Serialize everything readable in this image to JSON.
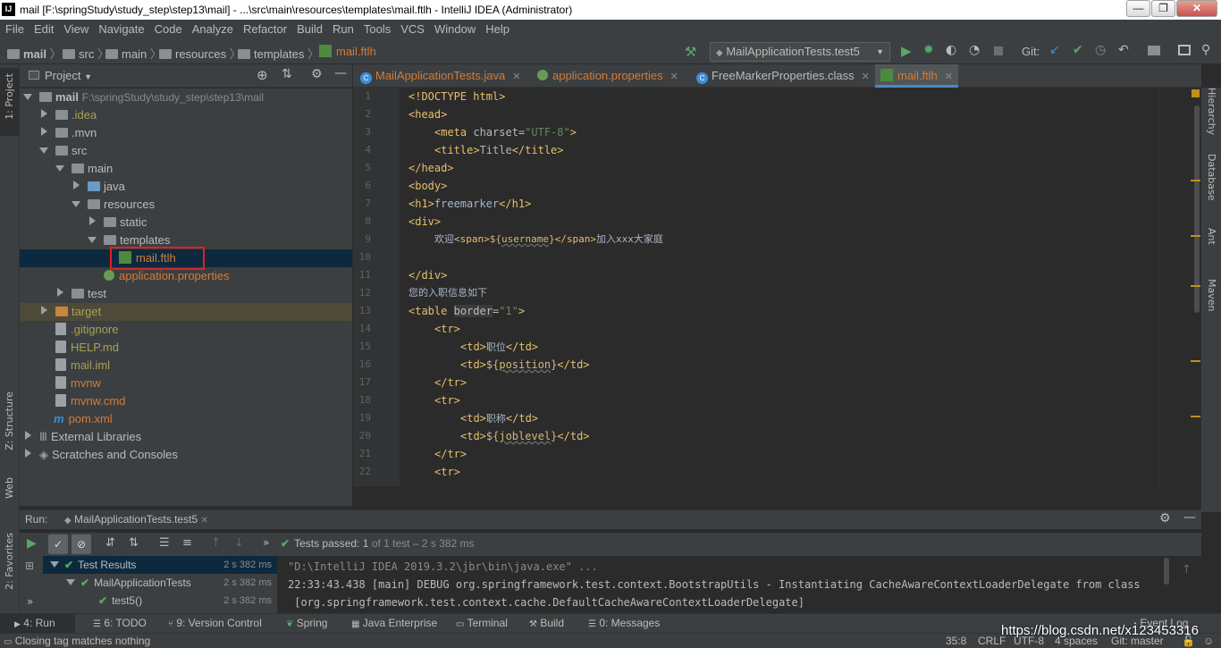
{
  "window": {
    "title": "mail [F:\\springStudy\\study_step\\step13\\mail] - ...\\src\\main\\resources\\templates\\mail.ftlh - IntelliJ IDEA (Administrator)",
    "app_icon": "IJ",
    "minimize": "—",
    "maximize": "❐",
    "close": "✕"
  },
  "menu": [
    "File",
    "Edit",
    "View",
    "Navigate",
    "Code",
    "Analyze",
    "Refactor",
    "Build",
    "Run",
    "Tools",
    "VCS",
    "Window",
    "Help"
  ],
  "breadcrumb": [
    "mail",
    "src",
    "main",
    "resources",
    "templates",
    "mail.ftlh"
  ],
  "run_config": "MailApplicationTests.test5",
  "git_label": "Git:",
  "left_strip": {
    "project": "1: Project",
    "structure": "Z: Structure",
    "web": "Web",
    "favorites": "2: Favorites"
  },
  "right_strip": [
    "Hierarchy",
    "Database",
    "Ant",
    "Maven"
  ],
  "project_panel": {
    "title": "Project",
    "tree": [
      {
        "label": "mail",
        "extra": "F:\\springStudy\\study_step\\step13\\mail"
      },
      {
        "label": ".idea"
      },
      {
        "label": ".mvn"
      },
      {
        "label": "src"
      },
      {
        "label": "main"
      },
      {
        "label": "java"
      },
      {
        "label": "resources"
      },
      {
        "label": "static"
      },
      {
        "label": "templates"
      },
      {
        "label": "mail.ftlh"
      },
      {
        "label": "application.properties"
      },
      {
        "label": "test"
      },
      {
        "label": "target"
      },
      {
        "label": ".gitignore"
      },
      {
        "label": "HELP.md"
      },
      {
        "label": "mail.iml"
      },
      {
        "label": "mvnw"
      },
      {
        "label": "mvnw.cmd"
      },
      {
        "label": "pom.xml"
      },
      {
        "label": "External Libraries"
      },
      {
        "label": "Scratches and Consoles"
      }
    ]
  },
  "editor_tabs": [
    "MailApplicationTests.java",
    "application.properties",
    "FreeMarkerProperties.class",
    "mail.ftlh"
  ],
  "code_lines": [
    "1",
    "2",
    "3",
    "4",
    "5",
    "6",
    "7",
    "8",
    "9",
    "10",
    "11",
    "12",
    "13",
    "14",
    "15",
    "16",
    "17",
    "18",
    "19",
    "20",
    "21",
    "22"
  ],
  "code": {
    "l1": "<!DOCTYPE html>",
    "l2": "<head>",
    "l3a": "<meta",
    "l3b": " charset=",
    "l3c": "\"UTF-8\"",
    "l3d": ">",
    "l4a": "<title>",
    "l4b": "Title",
    "l4c": "</title>",
    "l5": "</head>",
    "l6": "<body>",
    "l7a": "<h1>",
    "l7b": "freemarker",
    "l7c": "</h1>",
    "l8": "<div>",
    "l9a": "欢迎",
    "l9b": "<span>",
    "l9c": "${",
    "l9d": "username",
    "l9e": "}",
    "l9f": "</span>",
    "l9g": "加入xxx大家庭",
    "l11": "</div>",
    "l12": "您的入职信息如下",
    "l13a": "<table",
    "l13b": "border",
    "l13c": "=",
    "l13d": "\"1\"",
    "l13e": ">",
    "l14": "<tr>",
    "l15a": "<td>",
    "l15b": "职位",
    "l15c": "</td>",
    "l16a": "<td>",
    "l16b": "${",
    "l16c": "position",
    "l16d": "}",
    "l16e": "</td>",
    "l17": "</tr>",
    "l18": "<tr>",
    "l19a": "<td>",
    "l19b": "职称",
    "l19c": "</td>",
    "l20a": "<td>",
    "l20b": "${",
    "l20c": "joblevel",
    "l20d": "}",
    "l20e": "</td>",
    "l21": "</tr>",
    "l22": "<tr>"
  },
  "run_panel": {
    "label": "Run:",
    "config_tab": "MailApplicationTests.test5",
    "status": "Tests passed:",
    "status_count": "1",
    "status_detail": "of 1 test – 2 s 382 ms",
    "tree": [
      {
        "label": "Test Results",
        "duration": "2 s 382 ms"
      },
      {
        "label": "MailApplicationTests",
        "duration": "2 s 382 ms"
      },
      {
        "label": "test5()",
        "duration": "2 s 382 ms"
      }
    ],
    "console": [
      "\"D:\\IntelliJ IDEA 2019.3.2\\jbr\\bin\\java.exe\" ...",
      "22:33:43.438 [main] DEBUG org.springframework.test.context.BootstrapUtils - Instantiating CacheAwareContextLoaderDelegate from class",
      " [org.springframework.test.context.cache.DefaultCacheAwareContextLoaderDelegate]"
    ]
  },
  "bottom_tabs": [
    "4: Run",
    "6: TODO",
    "9: Version Control",
    "Spring",
    "Java Enterprise",
    "Terminal",
    "Build",
    "0: Messages"
  ],
  "event_log": "Event Log",
  "status_bar": {
    "message": "Closing tag matches nothing",
    "position": "35:8",
    "line_sep": "CRLF",
    "encoding": "UTF-8",
    "indent": "4 spaces",
    "git": "Git: master"
  },
  "watermark": "https://blog.csdn.net/x123453316",
  "colors": {
    "accent": "#4a88c7",
    "marker": "#be9117",
    "pass": "#59a869",
    "annotation": "#e02020"
  }
}
